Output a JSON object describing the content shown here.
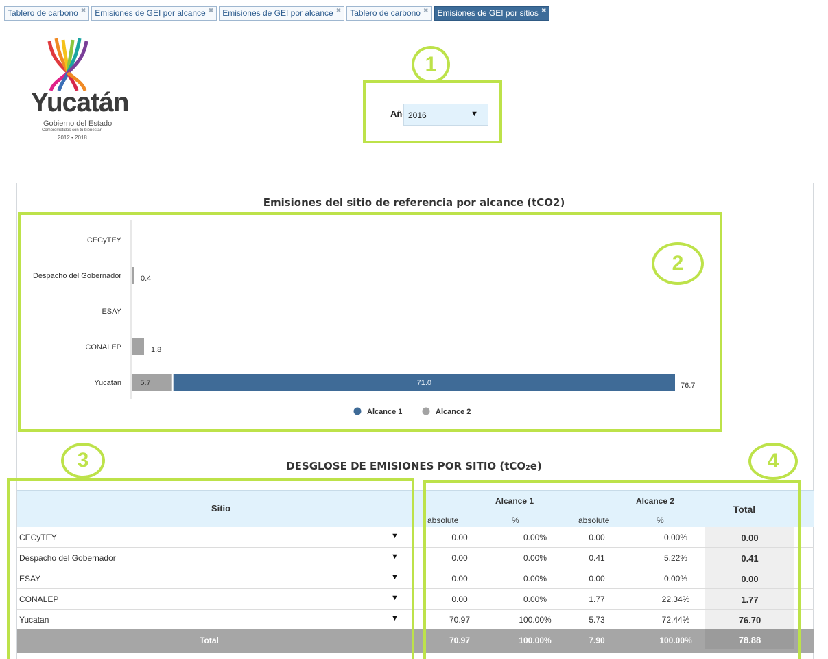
{
  "tabs": [
    {
      "label": "Tablero de carbono",
      "active": false
    },
    {
      "label": "Emisiones de GEI por alcance",
      "active": false
    },
    {
      "label": "Emisiones de GEI por alcance",
      "active": false
    },
    {
      "label": "Tablero de carbono",
      "active": false
    },
    {
      "label": "Emisiones de GEI por sitios",
      "active": true
    }
  ],
  "logo": {
    "name": "Yucatán",
    "subtitle": "Gobierno del Estado",
    "tagline": "Comprometidos con tu bienestar",
    "years": "2012 • 2018"
  },
  "annotations": [
    "1",
    "2",
    "3",
    "4"
  ],
  "year_filter": {
    "label": "Año",
    "value": "2016"
  },
  "chart_data": {
    "type": "bar",
    "orientation": "horizontal",
    "stacked": true,
    "title": "Emisiones del sitio de referencia por alcance (tCO2)",
    "categories": [
      "CECyTEY",
      "Despacho del Gobernador",
      "ESAY",
      "CONALEP",
      "Yucatan"
    ],
    "series": [
      {
        "name": "Alcance 1",
        "color": "#3f6b97",
        "values": [
          0,
          0,
          0,
          0,
          71.0
        ]
      },
      {
        "name": "Alcance 2",
        "color": "#a3a3a3",
        "values": [
          0,
          0.4,
          0,
          1.8,
          5.7
        ]
      }
    ],
    "totals": [
      null,
      0.4,
      null,
      1.8,
      76.7
    ],
    "segment_labels": [
      {
        "category": "Yucatan",
        "series": "Alcance 2",
        "label": "5.7"
      },
      {
        "category": "Yucatan",
        "series": "Alcance 1",
        "label": "71.0"
      }
    ],
    "total_labels": [
      "",
      "0.4",
      "",
      "1.8",
      "76.7"
    ],
    "legend": {
      "position": "bottom-center",
      "items": [
        "Alcance 1",
        "Alcance 2"
      ]
    }
  },
  "table": {
    "title": "DESGLOSE DE EMISIONES POR SITIO (tCO₂e)",
    "headers": {
      "sitio": "Sitio",
      "alcance1": "Alcance 1",
      "alcance2": "Alcance 2",
      "total": "Total",
      "absolute": "absolute",
      "pct": "%"
    },
    "rows": [
      {
        "sitio": "CECyTEY",
        "a1_abs": "0.00",
        "a1_pct": "0.00%",
        "a2_abs": "0.00",
        "a2_pct": "0.00%",
        "total": "0.00"
      },
      {
        "sitio": "Despacho del Gobernador",
        "a1_abs": "0.00",
        "a1_pct": "0.00%",
        "a2_abs": "0.41",
        "a2_pct": "5.22%",
        "total": "0.41"
      },
      {
        "sitio": "ESAY",
        "a1_abs": "0.00",
        "a1_pct": "0.00%",
        "a2_abs": "0.00",
        "a2_pct": "0.00%",
        "total": "0.00"
      },
      {
        "sitio": "CONALEP",
        "a1_abs": "0.00",
        "a1_pct": "0.00%",
        "a2_abs": "1.77",
        "a2_pct": "22.34%",
        "total": "1.77"
      },
      {
        "sitio": "Yucatan",
        "a1_abs": "70.97",
        "a1_pct": "100.00%",
        "a2_abs": "5.73",
        "a2_pct": "72.44%",
        "total": "76.70"
      }
    ],
    "total_row": {
      "label": "Total",
      "a1_abs": "70.97",
      "a1_pct": "100.00%",
      "a2_abs": "7.90",
      "a2_pct": "100.00%",
      "total": "78.88"
    }
  }
}
